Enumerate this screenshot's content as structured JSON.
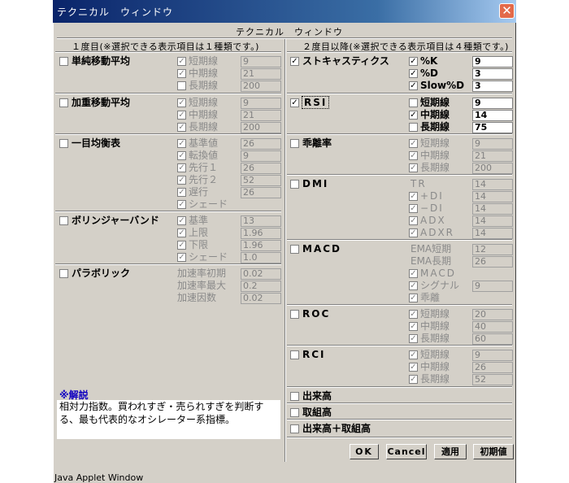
{
  "window": {
    "title": "テクニカル　ウィンドウ",
    "subtitle": "テクニカル　ウィンドウ",
    "close": "✕",
    "footer": "Java Applet Window"
  },
  "left_header": "１度目(※選択できる表示項目は１種類です。)",
  "right_header": "２度目以降(※選択できる表示項目は４種類です。)",
  "check": "✓",
  "left": {
    "sma": {
      "label": "単純移動平均",
      "rows": [
        {
          "label": "短期線",
          "value": "9"
        },
        {
          "label": "中期線",
          "value": "21"
        },
        {
          "label": "長期線",
          "value": "200"
        }
      ]
    },
    "wma": {
      "label": "加重移動平均",
      "rows": [
        {
          "label": "短期線",
          "value": "9"
        },
        {
          "label": "中期線",
          "value": "21"
        },
        {
          "label": "長期線",
          "value": "200"
        }
      ]
    },
    "ichimoku": {
      "label": "一目均衡表",
      "rows": [
        {
          "label": "基準値",
          "value": "26"
        },
        {
          "label": "転換値",
          "value": "9"
        },
        {
          "label": "先行１",
          "value": "26"
        },
        {
          "label": "先行２",
          "value": "52"
        },
        {
          "label": "遅行",
          "value": "26"
        },
        {
          "label": "シェード",
          "value": ""
        }
      ]
    },
    "bollinger": {
      "label": "ボリンジャーバンド",
      "rows": [
        {
          "label": "基準",
          "value": "13"
        },
        {
          "label": "上限",
          "value": "1.96"
        },
        {
          "label": "下限",
          "value": "1.96"
        },
        {
          "label": "シェード",
          "value": "1.0"
        }
      ]
    },
    "parabolic": {
      "label": "パラボリック",
      "rows": [
        {
          "label": "加速率初期",
          "value": "0.02"
        },
        {
          "label": "加速率最大",
          "value": "0.2"
        },
        {
          "label": "加速因数",
          "value": "0.02"
        }
      ]
    }
  },
  "right": {
    "stoch": {
      "label": "ストキャスティクス",
      "rows": [
        {
          "label": "%K",
          "value": "9"
        },
        {
          "label": "%D",
          "value": "3"
        },
        {
          "label": "Slow%D",
          "value": "3"
        }
      ]
    },
    "rsi": {
      "label": "RSI",
      "rows": [
        {
          "label": "短期線",
          "value": "9"
        },
        {
          "label": "中期線",
          "value": "14"
        },
        {
          "label": "長期線",
          "value": "75"
        }
      ]
    },
    "kairi": {
      "label": "乖離率",
      "rows": [
        {
          "label": "短期線",
          "value": "9"
        },
        {
          "label": "中期線",
          "value": "21"
        },
        {
          "label": "長期線",
          "value": "200"
        }
      ]
    },
    "dmi": {
      "label": "DMI",
      "rows": [
        {
          "label": "TR",
          "value": "14"
        },
        {
          "label": "+DI",
          "value": "14"
        },
        {
          "label": "−DI",
          "value": "14"
        },
        {
          "label": "ADX",
          "value": "14"
        },
        {
          "label": "ADXR",
          "value": "14"
        }
      ]
    },
    "macd": {
      "label": "MACD",
      "rows": [
        {
          "label": "EMA短期",
          "value": "12"
        },
        {
          "label": "EMA長期",
          "value": "26"
        },
        {
          "label": "MACD",
          "value": ""
        },
        {
          "label": "シグナル",
          "value": "9"
        },
        {
          "label": "乖離",
          "value": ""
        }
      ]
    },
    "roc": {
      "label": "ROC",
      "rows": [
        {
          "label": "短期線",
          "value": "20"
        },
        {
          "label": "中期線",
          "value": "40"
        },
        {
          "label": "長期線",
          "value": "60"
        }
      ]
    },
    "rci": {
      "label": "RCI",
      "rows": [
        {
          "label": "短期線",
          "value": "9"
        },
        {
          "label": "中期線",
          "value": "26"
        },
        {
          "label": "長期線",
          "value": "52"
        }
      ]
    },
    "volume": {
      "label": "出来高"
    },
    "oi": {
      "label": "取組高"
    },
    "vol_oi": {
      "label": "出来高＋取組高"
    }
  },
  "note": {
    "title": "※解説",
    "text": "相対力指数。買われすぎ・売られすぎを判断する、最も代表的なオシレーター系指標。"
  },
  "buttons": {
    "ok": "OK",
    "cancel": "Cancel",
    "apply": "適用",
    "default": "初期値"
  }
}
